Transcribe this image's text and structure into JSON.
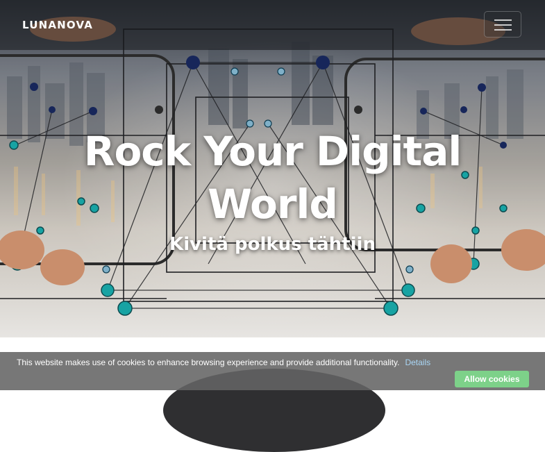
{
  "navbar": {
    "brand": "LUNANOVA",
    "menu_icon": "hamburger-menu-icon"
  },
  "hero": {
    "title": "Rock Your Digital World",
    "subtitle": "Kivitä polkus tähtiin"
  },
  "cookie_banner": {
    "message": "This website makes use of cookies to enhance browsing experience and provide additional functionality.",
    "details_link": "Details",
    "allow_button": "Allow cookies",
    "colors": {
      "bar": "#646464",
      "link": "#a9d6f5",
      "button": "#7dd189"
    }
  }
}
